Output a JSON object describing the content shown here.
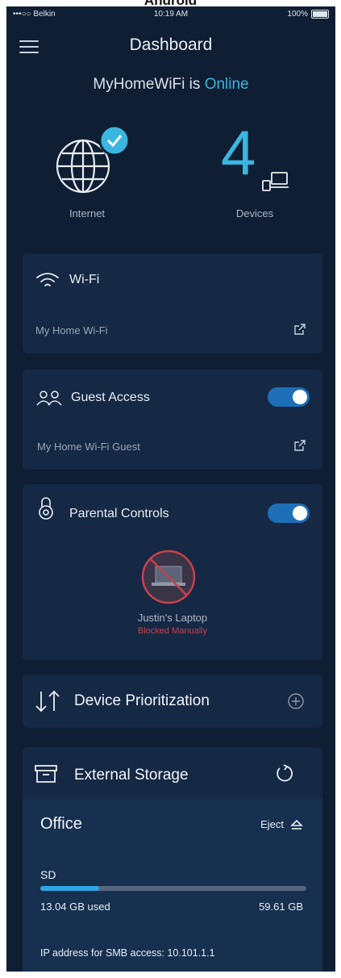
{
  "caption": "Android",
  "status_bar": {
    "carrier": "•••○○ Belkin",
    "time": "10:19 AM",
    "battery": "100%"
  },
  "header": {
    "title": "Dashboard"
  },
  "network": {
    "name": "MyHomeWiFi",
    "connector": "is",
    "status": "Online"
  },
  "internet": {
    "label": "Internet"
  },
  "devices": {
    "count": "4",
    "label": "Devices"
  },
  "wifi_card": {
    "title": "Wi-Fi",
    "network_name": "My Home Wi-Fi"
  },
  "guest_card": {
    "title": "Guest Access",
    "network_name": "My Home Wi-Fi Guest",
    "enabled": true
  },
  "parental_card": {
    "title": "Parental Controls",
    "enabled": true,
    "device_name": "Justin's Laptop",
    "device_status": "Blocked Manually"
  },
  "prioritization_card": {
    "title": "Device Prioritization"
  },
  "storage_card": {
    "title": "External Storage",
    "location": "Office",
    "eject_label": "Eject",
    "drive_label": "SD",
    "used": "13.04 GB used",
    "total": "59.61 GB",
    "used_fraction": 0.22,
    "smb_info": "IP address for SMB access: 10.101.1.1"
  },
  "colors": {
    "background": "#0f1e33",
    "card": "#152844",
    "accent": "#39b7e0",
    "toggle": "#1d6fb8",
    "blocked": "#c9414b"
  }
}
